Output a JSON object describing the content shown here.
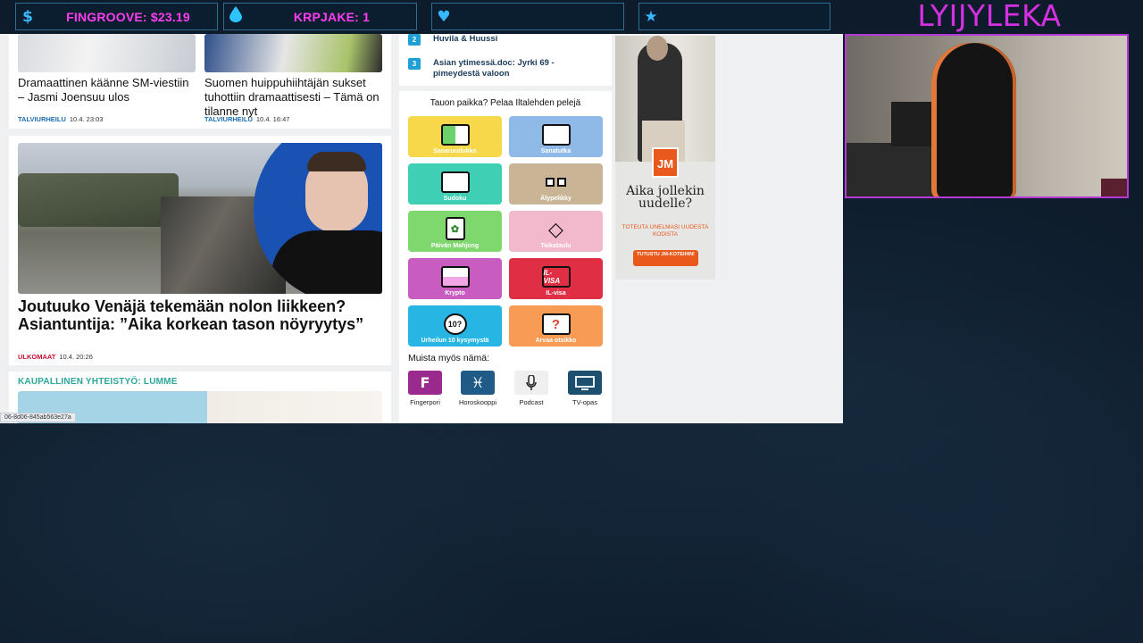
{
  "overlay": {
    "boxes": [
      {
        "icon": "dollar-icon",
        "glyph": "$",
        "text": "FINGROOVE: $23.19"
      },
      {
        "icon": "drop-icon",
        "glyph": "💧",
        "text": "KRPJAKE: 1"
      },
      {
        "icon": "heart-icon",
        "glyph": "♥",
        "text": ""
      },
      {
        "icon": "star-icon",
        "glyph": "★",
        "text": ""
      }
    ],
    "streamer": "LYIJYLEKA"
  },
  "page": {
    "top_stories": [
      {
        "headline": "Dramaattinen käänne SM-viestiin – Jasmi Joensuu ulos",
        "category": "TALVIURHEILU",
        "time": "10.4. 23:03"
      },
      {
        "headline": "Suomen huippuhiihtäjän sukset tuhottiin dramaattisesti – Tämä on tilanne nyt",
        "category": "TALVIURHEILU",
        "time": "10.4. 16:47"
      }
    ],
    "main_story": {
      "headline": "Joutuuko Venäjä tekemään nolon liikkeen? Asiantuntija: ”Aika korkean tason nöyryytys”",
      "category": "ULKOMAAT",
      "time": "10.4. 20:26"
    },
    "sponsored_label": "KAUPALLINEN YHTEISTYÖ: LUMME",
    "status_url": "06-8d06-845ab563e27a",
    "toplist": [
      {
        "num": "2",
        "text": "Huvila & Huussi"
      },
      {
        "num": "3",
        "text": "Asian ytimessä.doc: Jyrki 69 - pimeydestä valoon"
      }
    ],
    "games_title": "Tauon paikka? Pelaa Iltalehden pelejä",
    "games": [
      {
        "label": "Sanaruudukko",
        "color": "#f6d84a",
        "icon": "grid-icon",
        "glyph": "▦"
      },
      {
        "label": "Sanatutka",
        "color": "#8fb9e6",
        "icon": "radar-icon",
        "glyph": "◩"
      },
      {
        "label": "Sudoku",
        "color": "#3ecfb4",
        "icon": "sudoku-icon",
        "glyph": "▥"
      },
      {
        "label": "Älypelikky",
        "color": "#c9b596",
        "icon": "blocks-icon",
        "glyph": "▪▪"
      },
      {
        "label": "Päivän Mahjong",
        "color": "#7fd86e",
        "icon": "mahjong-icon",
        "glyph": "✿"
      },
      {
        "label": "Taikataulu",
        "color": "#f2b8cb",
        "icon": "diamond-icon",
        "glyph": "◇"
      },
      {
        "label": "Krypto",
        "color": "#c95cc0",
        "icon": "crypto-icon",
        "glyph": "▤"
      },
      {
        "label": "IL-visa",
        "color": "#e02f45",
        "icon": "ilvisa-icon",
        "glyph": "IL"
      },
      {
        "label": "Urheilun 10 kysymystä",
        "color": "#27b6e4",
        "icon": "ten-questions-icon",
        "glyph": "10?"
      },
      {
        "label": "Arvaa otsikko",
        "color": "#f79b55",
        "icon": "question-icon",
        "glyph": "?"
      }
    ],
    "remember_title": "Muista myös nämä:",
    "apps": [
      {
        "label": "Fingerpori",
        "color": "#9b2a8e",
        "icon": "fingerpori-icon",
        "glyph": "F"
      },
      {
        "label": "Horoskooppi",
        "color": "#1f5b86",
        "icon": "pisces-icon",
        "glyph": "♓"
      },
      {
        "label": "Podcast",
        "color": "#efefef",
        "icon": "microphone-icon",
        "glyph": "🎙"
      },
      {
        "label": "TV-opas",
        "color": "#1d4f6f",
        "icon": "tv-icon",
        "glyph": "▭"
      }
    ],
    "ad": {
      "logo": "JM",
      "headline": "Aika jollekin uudelle?",
      "subtext": "TOTEUTA UNELMASI UUDESTA KODISTA",
      "button": "TUTUSTU JM-KOTEIHIN!"
    }
  }
}
